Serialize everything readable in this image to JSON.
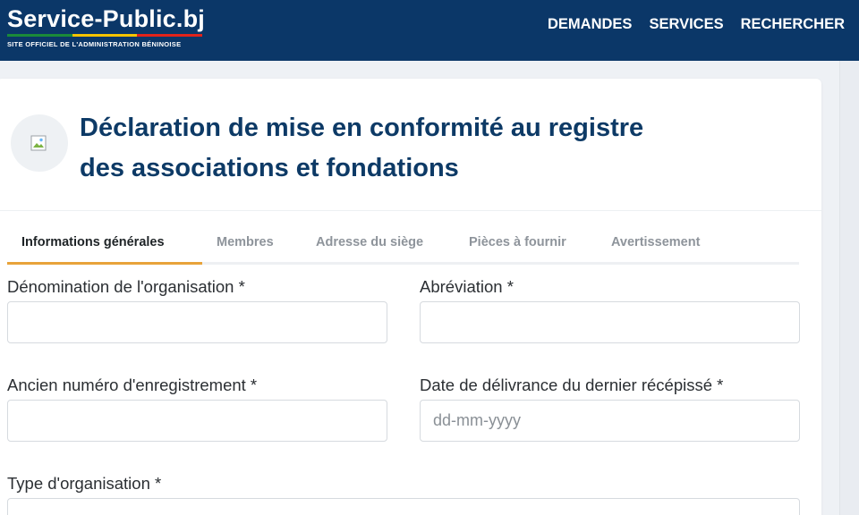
{
  "header": {
    "logo_title": "Service-Public.bj",
    "logo_subtitle": "SITE OFFICIEL DE L'ADMINISTRATION BÉNINOISE",
    "nav": [
      "DEMANDES",
      "SERVICES",
      "RECHERCHER"
    ],
    "background_color": "#0b3768",
    "flag_colors": [
      "#1a8a3a",
      "#f5c400",
      "#e2231a"
    ]
  },
  "page": {
    "title_line1": "Déclaration de mise en conformité au registre",
    "title_line2": "des associations et fondations",
    "title_color": "#0d3a66"
  },
  "tabs": [
    {
      "label": "Informations générales",
      "active": true
    },
    {
      "label": "Membres",
      "active": false
    },
    {
      "label": "Adresse du siège",
      "active": false
    },
    {
      "label": "Pièces à fournir",
      "active": false
    },
    {
      "label": "Avertissement",
      "active": false
    }
  ],
  "accent_color": "#e8a33a",
  "form": {
    "denomination_label": "Dénomination de l'organisation *",
    "denomination_value": "",
    "abbreviation_label": "Abréviation *",
    "abbreviation_value": "",
    "old_number_label": "Ancien numéro d'enregistrement *",
    "old_number_value": "",
    "date_label": "Date de délivrance du dernier récépissé *",
    "date_placeholder": "dd-mm-yyyy",
    "type_label": "Type d'organisation *"
  }
}
